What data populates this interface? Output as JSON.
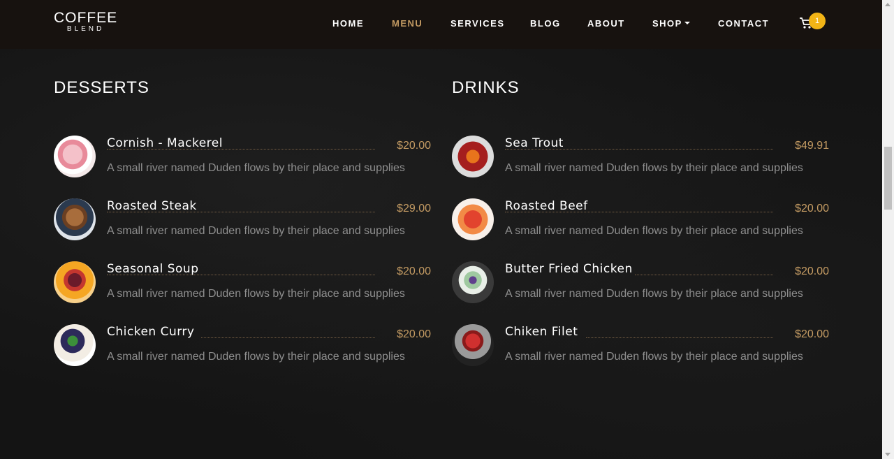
{
  "brand": {
    "line1": "COFFEE",
    "line2": "BLEND"
  },
  "nav": {
    "items": [
      {
        "label": "HOME"
      },
      {
        "label": "MENU",
        "active": true
      },
      {
        "label": "SERVICES"
      },
      {
        "label": "BLOG"
      },
      {
        "label": "ABOUT"
      },
      {
        "label": "SHOP"
      },
      {
        "label": "CONTACT"
      }
    ],
    "cart_count": "1"
  },
  "colors": {
    "accent": "#c49b63",
    "badge": "#f2b416",
    "nav_bg": "#17120f"
  },
  "desserts": {
    "title": "DESSERTS",
    "items": [
      {
        "name": "Cornish - Mackerel",
        "price": "$20.00",
        "desc": "A small river named Duden flows by their place and supplies",
        "icon": "dessert-cake-image"
      },
      {
        "name": "Roasted Steak",
        "price": "$29.00",
        "desc": "A small river named Duden flows by their place and supplies",
        "icon": "dessert-pancake-image"
      },
      {
        "name": "Seasonal Soup",
        "price": "$20.00",
        "desc": "A small river named Duden flows by their place and supplies",
        "icon": "dessert-tart-image"
      },
      {
        "name": "Chicken Curry",
        "price": "$20.00",
        "desc": "A small river named Duden flows by their place and supplies",
        "icon": "dessert-cheesecake-image"
      }
    ]
  },
  "drinks": {
    "title": "DRINKS",
    "items": [
      {
        "name": "Sea Trout",
        "price": "$49.91",
        "desc": "A small river named Duden flows by their place and supplies",
        "icon": "drink-cocktail-image"
      },
      {
        "name": "Roasted Beef",
        "price": "$20.00",
        "desc": "A small river named Duden flows by their place and supplies",
        "icon": "drink-juice-image"
      },
      {
        "name": "Butter Fried Chicken",
        "price": "$20.00",
        "desc": "A small river named Duden flows by their place and supplies",
        "icon": "drink-gin-tonic-image"
      },
      {
        "name": "Chiken Filet",
        "price": "$20.00",
        "desc": "A small river named Duden flows by their place and supplies",
        "icon": "drink-red-cocktail-image"
      }
    ]
  }
}
